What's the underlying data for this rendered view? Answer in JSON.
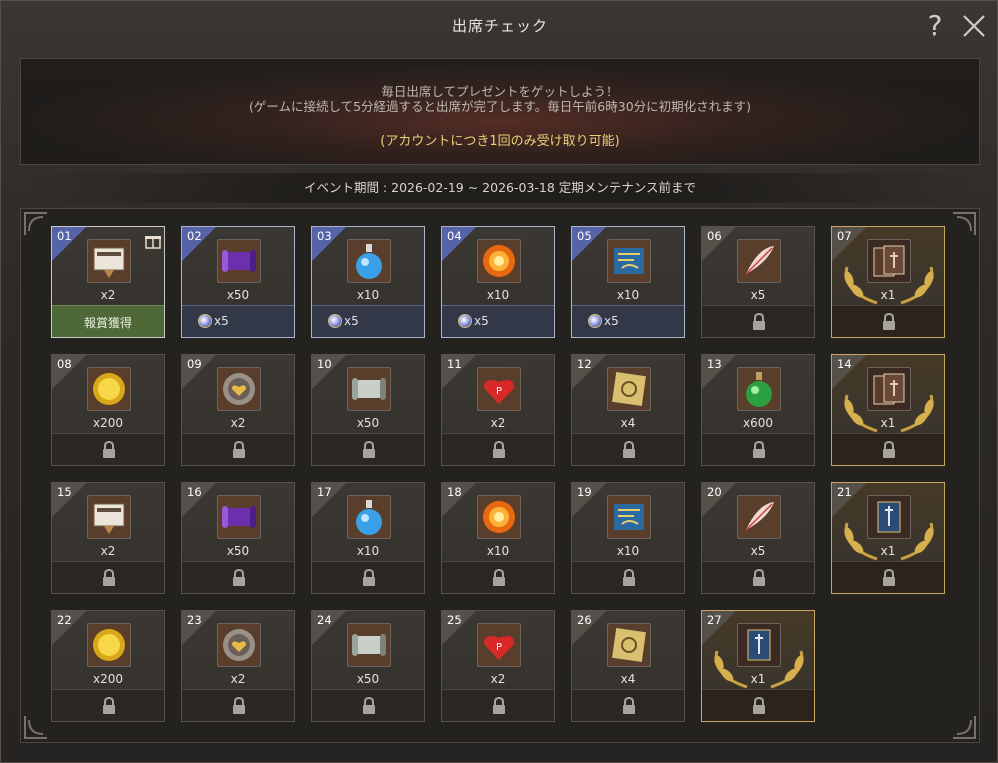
{
  "window": {
    "title": "出席チェック",
    "help_label": "?"
  },
  "banner": {
    "line1": "毎日出席してプレゼントをゲットしよう！",
    "line2": "(ゲームに接続して5分経過すると出席が完了します。毎日午前6時30分に初期化されます)",
    "line3": "(アカウントにつき1回のみ受け取り可能)"
  },
  "period": "イベント期間 : 2026-02-19 ~ 2026-03-18 定期メンテナンス前まで",
  "days": [
    {
      "day": "01",
      "qty": "x2",
      "icon": "ticket-hourglass-icon",
      "status": "claimed",
      "foot": "報賞獲得",
      "gift": true
    },
    {
      "day": "02",
      "qty": "x50",
      "icon": "purple-scroll-icon",
      "status": "claimed",
      "bonus": "x5"
    },
    {
      "day": "03",
      "qty": "x10",
      "icon": "blue-potion-icon",
      "status": "claimed",
      "bonus": "x5"
    },
    {
      "day": "04",
      "qty": "x10",
      "icon": "fire-orb-icon",
      "status": "claimed",
      "bonus": "x5"
    },
    {
      "day": "05",
      "qty": "x10",
      "icon": "blue-map-icon",
      "status": "claimed",
      "bonus": "x5"
    },
    {
      "day": "06",
      "qty": "x5",
      "icon": "feather-icon",
      "status": "locked"
    },
    {
      "day": "07",
      "qty": "x1",
      "icon": "card-pack-icon",
      "status": "locked",
      "special": true
    },
    {
      "day": "08",
      "qty": "x200",
      "icon": "gold-coin-icon",
      "status": "locked"
    },
    {
      "day": "09",
      "qty": "x2",
      "icon": "heart-medal-icon",
      "status": "locked"
    },
    {
      "day": "10",
      "qty": "x50",
      "icon": "paper-scroll-icon",
      "status": "locked"
    },
    {
      "day": "11",
      "qty": "x2",
      "icon": "red-heart-icon",
      "status": "locked"
    },
    {
      "day": "12",
      "qty": "x4",
      "icon": "rune-stone-icon",
      "status": "locked"
    },
    {
      "day": "13",
      "qty": "x600",
      "icon": "green-potion-icon",
      "status": "locked"
    },
    {
      "day": "14",
      "qty": "x1",
      "icon": "card-pack-icon",
      "status": "locked",
      "special": true
    },
    {
      "day": "15",
      "qty": "x2",
      "icon": "ticket-hourglass-icon",
      "status": "locked"
    },
    {
      "day": "16",
      "qty": "x50",
      "icon": "purple-scroll-icon",
      "status": "locked"
    },
    {
      "day": "17",
      "qty": "x10",
      "icon": "blue-potion-icon",
      "status": "locked"
    },
    {
      "day": "18",
      "qty": "x10",
      "icon": "fire-orb-icon",
      "status": "locked"
    },
    {
      "day": "19",
      "qty": "x10",
      "icon": "blue-map-icon",
      "status": "locked"
    },
    {
      "day": "20",
      "qty": "x5",
      "icon": "feather-icon",
      "status": "locked"
    },
    {
      "day": "21",
      "qty": "x1",
      "icon": "sword-card-icon",
      "status": "locked",
      "special": true
    },
    {
      "day": "22",
      "qty": "x200",
      "icon": "gold-coin-icon",
      "status": "locked"
    },
    {
      "day": "23",
      "qty": "x2",
      "icon": "heart-medal-icon",
      "status": "locked"
    },
    {
      "day": "24",
      "qty": "x50",
      "icon": "paper-scroll-icon",
      "status": "locked"
    },
    {
      "day": "25",
      "qty": "x2",
      "icon": "red-heart-icon",
      "status": "locked"
    },
    {
      "day": "26",
      "qty": "x4",
      "icon": "rune-stone-icon",
      "status": "locked"
    },
    {
      "day": "27",
      "qty": "x1",
      "icon": "sword-card-icon",
      "status": "locked",
      "special": true
    }
  ]
}
